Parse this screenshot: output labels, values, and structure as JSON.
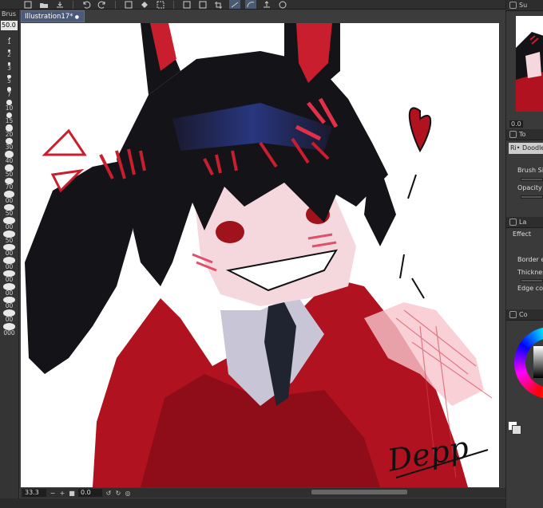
{
  "brush_size": {
    "palette_title": "Brus",
    "current_value": "50.0",
    "sizes": [
      "1",
      "2",
      "3",
      "5",
      "7",
      "10",
      "15",
      "20",
      "30",
      "40",
      "50",
      "70",
      "00",
      "50",
      "00",
      "50",
      "00",
      "00",
      "00",
      "00",
      "00",
      "00",
      "000"
    ]
  },
  "document": {
    "tab_title": "Illustration17*",
    "signature": "Depp"
  },
  "statusbar": {
    "zoom": "33.3",
    "rotation": "0.0"
  },
  "right_dock": {
    "navigator_tab": "Su",
    "navigator_value": "0.0",
    "tool_property_tab": "To",
    "brush_name": "Ri• Doodle",
    "brush_size_label": "Brush Si",
    "opacity_label": "Opacity",
    "layer_property_tab": "La",
    "effect_label": "Effect",
    "border_label": "Border e",
    "thickness_label": "Thicknes",
    "edge_label": "Edge co",
    "color_tab": "Co"
  },
  "colors": {
    "accent": "#4a5a78",
    "hair": "#141318",
    "hood": "#b0121f",
    "skin": "#f4d8de",
    "shirt": "#c8c6d6",
    "ribbon": "#c81e2e"
  }
}
